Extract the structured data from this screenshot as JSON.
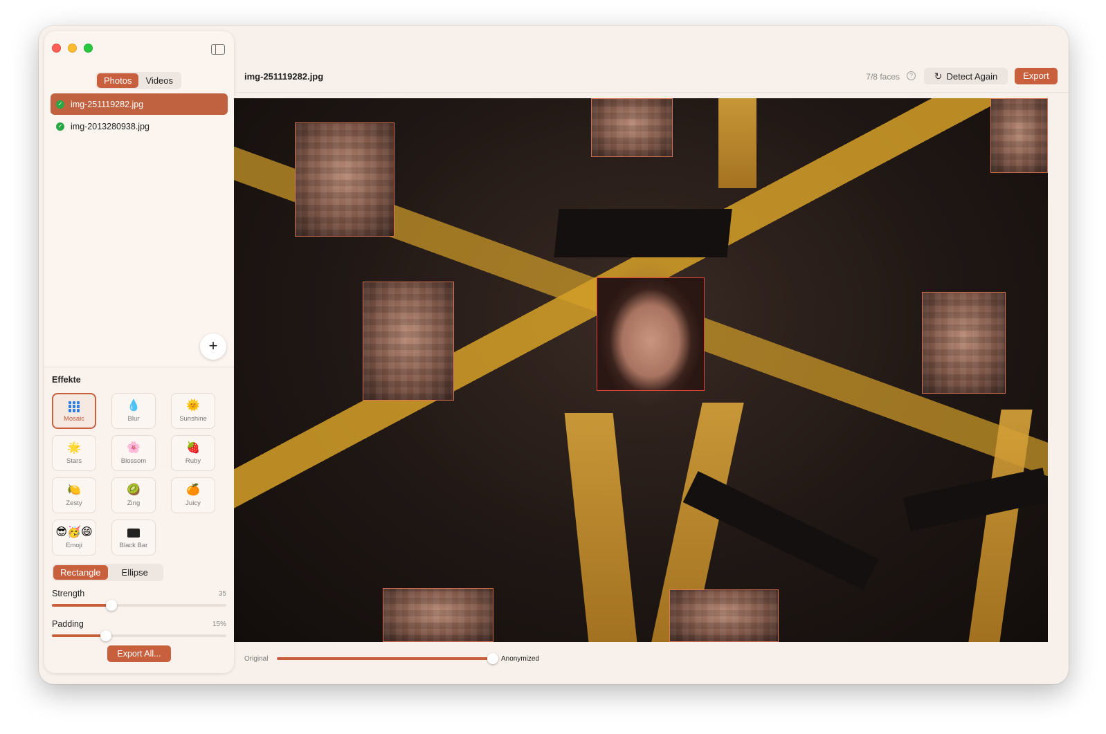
{
  "sidebar": {
    "media_tabs": [
      {
        "label": "Photos",
        "active": true
      },
      {
        "label": "Videos",
        "active": false
      }
    ],
    "files": [
      {
        "name": "img-251119282.jpg",
        "status": "done",
        "active": true
      },
      {
        "name": "img-2013280938.jpg",
        "status": "done",
        "active": false
      }
    ],
    "add_label": "+",
    "effects_title": "Effekte",
    "effects": [
      {
        "label": "Mosaic",
        "icon": "mosaic-icon",
        "active": true
      },
      {
        "label": "Blur",
        "icon": "💧"
      },
      {
        "label": "Sunshine",
        "icon": "🌞"
      },
      {
        "label": "Stars",
        "icon": "🌟"
      },
      {
        "label": "Blossom",
        "icon": "🌸"
      },
      {
        "label": "Ruby",
        "icon": "🍓"
      },
      {
        "label": "Zesty",
        "icon": "🍋"
      },
      {
        "label": "Zing",
        "icon": "🥝"
      },
      {
        "label": "Juicy",
        "icon": "🍊"
      },
      {
        "label": "Emoji",
        "icon": "😎🥳😄"
      },
      {
        "label": "Black Bar",
        "icon": "black-bar-icon"
      }
    ],
    "shape_tabs": [
      {
        "label": "Rectangle",
        "active": true
      },
      {
        "label": "Ellipse",
        "active": false
      }
    ],
    "strength": {
      "label": "Strength",
      "value": "35",
      "fraction": 0.34
    },
    "padding": {
      "label": "Padding",
      "value": "15%",
      "fraction": 0.31
    },
    "export_all_label": "Export All..."
  },
  "header": {
    "title": "img-251119282.jpg",
    "faces": "7/8 faces",
    "help": "?",
    "detect_again": "Detect Again",
    "export": "Export"
  },
  "compare": {
    "left_label": "Original",
    "right_label": "Anonymized",
    "fraction": 1.0
  },
  "colors": {
    "accent": "#c8603e",
    "face_box": "#e0433a"
  }
}
